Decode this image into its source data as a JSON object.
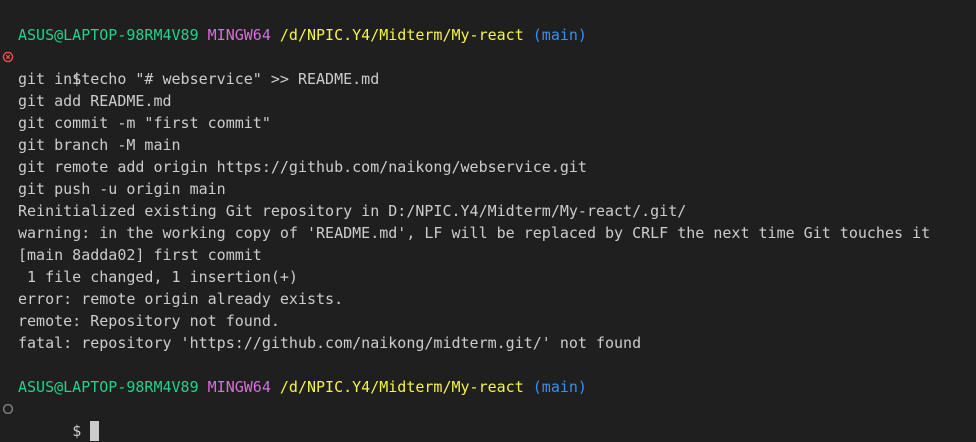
{
  "prompt1": {
    "user_host": "ASUS@LAPTOP-98RM4V89",
    "env": "MINGW64",
    "path": "/d/NPIC.Y4/Midterm/My-react",
    "branch": "(main)"
  },
  "command_lines": [
    "$ echo \"# webservice\" >> README.md",
    "git init",
    "git add README.md",
    "git commit -m \"first commit\"",
    "git branch -M main",
    "git remote add origin https://github.com/naikong/webservice.git",
    "git push -u origin main"
  ],
  "output_lines": [
    "Reinitialized existing Git repository in D:/NPIC.Y4/Midterm/My-react/.git/",
    "warning: in the working copy of 'README.md', LF will be replaced by CRLF the next time Git touches it",
    "[main 8adda02] first commit",
    " 1 file changed, 1 insertion(+)",
    "error: remote origin already exists.",
    "remote: Repository not found.",
    "fatal: repository 'https://github.com/naikong/midterm.git/' not found"
  ],
  "prompt2": {
    "user_host": "ASUS@LAPTOP-98RM4V89",
    "env": "MINGW64",
    "path": "/d/NPIC.Y4/Midterm/My-react",
    "branch": "(main)"
  },
  "input_prompt": "$ ",
  "icons": {
    "error_decoration": "circle-x-icon",
    "default_decoration": "circle-icon"
  },
  "colors": {
    "background": "#1f1f1f",
    "foreground": "#cccccc",
    "user_host": "#23d18b",
    "env": "#d670d6",
    "path": "#f5f543",
    "branch": "#3b8eea",
    "error_decoration": "#f14c4c",
    "default_decoration": "#8b8b8b"
  }
}
